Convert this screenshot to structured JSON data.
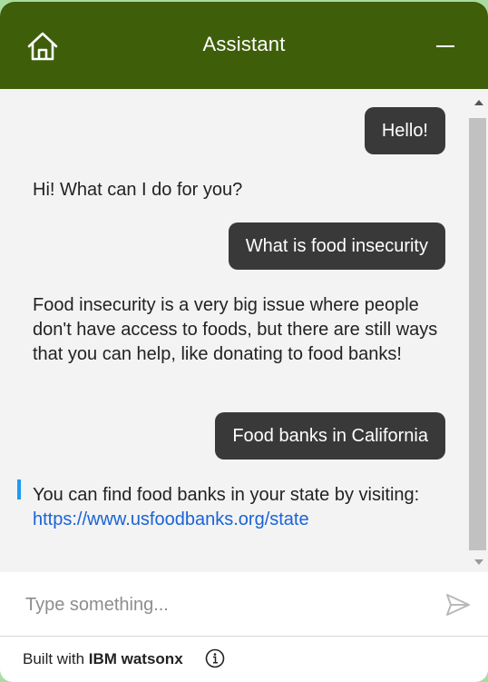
{
  "header": {
    "title": "Assistant",
    "home_icon": "home-icon",
    "minimize_icon": "minimize-icon",
    "background_color": "#3f5e0a"
  },
  "messages": [
    {
      "role": "user",
      "text": "Hello!"
    },
    {
      "role": "assistant",
      "text": "Hi! What can I do for you?"
    },
    {
      "role": "user",
      "text": "What is food insecurity"
    },
    {
      "role": "assistant",
      "text": "Food insecurity is a very big issue where people don't have access to foods, but there are still ways that you can help, like donating to food banks!"
    },
    {
      "role": "user",
      "text": "Food banks in California"
    },
    {
      "role": "assistant",
      "text": "You can find food banks in your state by visiting:",
      "link": "https://www.usfoodbanks.org/state"
    }
  ],
  "input": {
    "placeholder": "Type something...",
    "value": "",
    "send_icon": "send-icon"
  },
  "footer": {
    "prefix": "Built with ",
    "brand": "IBM watsonx",
    "info_icon": "info-icon"
  },
  "colors": {
    "user_bubble": "#393939",
    "link": "#1a63d6",
    "accent": "#1d9bf0"
  }
}
